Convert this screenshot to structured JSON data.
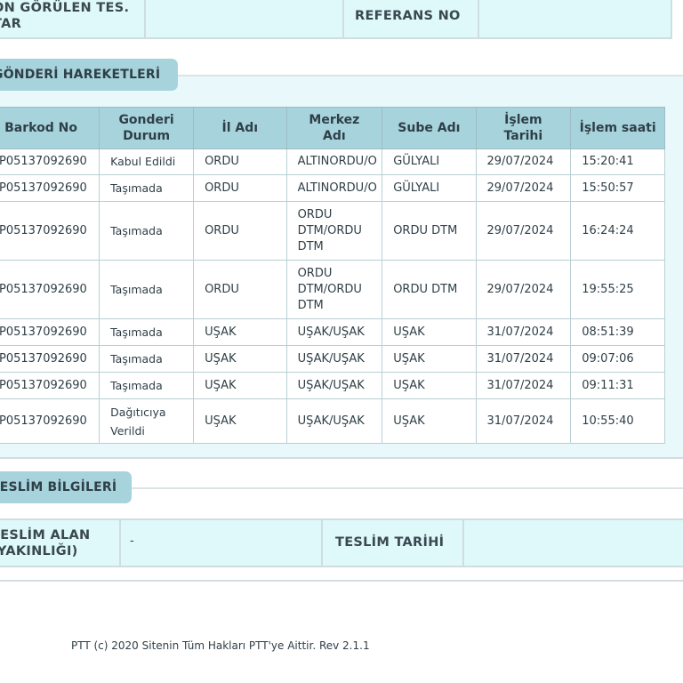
{
  "top_info": {
    "label_left": "ON GÖRÜLEN TES.\nTAR",
    "value_left": "",
    "label_reference": "REFERANS NO",
    "value_reference": ""
  },
  "movements": {
    "title": "GÖNDERİ HAREKETLERİ",
    "columns": [
      "Barkod No",
      "Gonderi Durum",
      "İl Adı",
      "Merkez Adı",
      "Sube Adı",
      "İşlem Tarihi",
      "İşlem saati"
    ],
    "rows": [
      {
        "barcode": "P05137092690",
        "status": "Kabul Edildi",
        "city": "ORDU",
        "center": "ALTINORDU/O",
        "branch": "GÜLYALI",
        "date": "29/07/2024",
        "time": "15:20:41"
      },
      {
        "barcode": "P05137092690",
        "status": "Taşımada",
        "city": "ORDU",
        "center": "ALTINORDU/O",
        "branch": "GÜLYALI",
        "date": "29/07/2024",
        "time": "15:50:57"
      },
      {
        "barcode": "P05137092690",
        "status": "Taşımada",
        "city": "ORDU",
        "center": "ORDU DTM/ORDU DTM",
        "branch": "ORDU DTM",
        "date": "29/07/2024",
        "time": "16:24:24"
      },
      {
        "barcode": "P05137092690",
        "status": "Taşımada",
        "city": "ORDU",
        "center": "ORDU DTM/ORDU DTM",
        "branch": "ORDU DTM",
        "date": "29/07/2024",
        "time": "19:55:25"
      },
      {
        "barcode": "P05137092690",
        "status": "Taşımada",
        "city": "UŞAK",
        "center": "UŞAK/UŞAK",
        "branch": "UŞAK",
        "date": "31/07/2024",
        "time": "08:51:39"
      },
      {
        "barcode": "P05137092690",
        "status": "Taşımada",
        "city": "UŞAK",
        "center": "UŞAK/UŞAK",
        "branch": "UŞAK",
        "date": "31/07/2024",
        "time": "09:07:06"
      },
      {
        "barcode": "P05137092690",
        "status": "Taşımada",
        "city": "UŞAK",
        "center": "UŞAK/UŞAK",
        "branch": "UŞAK",
        "date": "31/07/2024",
        "time": "09:11:31"
      },
      {
        "barcode": "P05137092690",
        "status": "Dağıtıcıya Verildi",
        "city": "UŞAK",
        "center": "UŞAK/UŞAK",
        "branch": "UŞAK",
        "date": "31/07/2024",
        "time": "10:55:40"
      }
    ]
  },
  "delivery": {
    "title": "TESLİM BİLGİLERİ",
    "label_receiver": "TESLİM ALAN\n(YAKINLIĞI)",
    "value_receiver": "-",
    "label_date": "TESLİM TARİHİ",
    "value_date": ""
  },
  "footer": "PTT (c) 2020 Sitenin Tüm Hakları PTT'ye Aittir. Rev 2.1.1"
}
